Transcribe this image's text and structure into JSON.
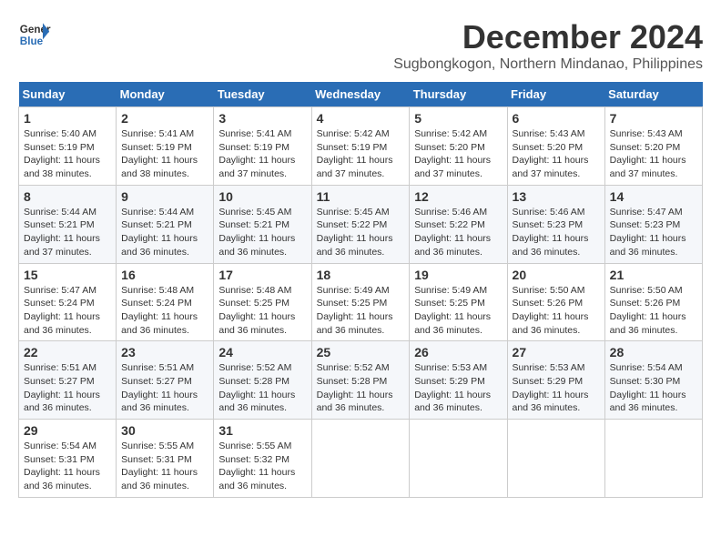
{
  "header": {
    "logo_line1": "General",
    "logo_line2": "Blue",
    "month_title": "December 2024",
    "location": "Sugbongkogon, Northern Mindanao, Philippines"
  },
  "calendar": {
    "days_of_week": [
      "Sunday",
      "Monday",
      "Tuesday",
      "Wednesday",
      "Thursday",
      "Friday",
      "Saturday"
    ],
    "weeks": [
      [
        {
          "day": "",
          "info": ""
        },
        {
          "day": "2",
          "info": "Sunrise: 5:41 AM\nSunset: 5:19 PM\nDaylight: 11 hours\nand 38 minutes."
        },
        {
          "day": "3",
          "info": "Sunrise: 5:41 AM\nSunset: 5:19 PM\nDaylight: 11 hours\nand 37 minutes."
        },
        {
          "day": "4",
          "info": "Sunrise: 5:42 AM\nSunset: 5:19 PM\nDaylight: 11 hours\nand 37 minutes."
        },
        {
          "day": "5",
          "info": "Sunrise: 5:42 AM\nSunset: 5:20 PM\nDaylight: 11 hours\nand 37 minutes."
        },
        {
          "day": "6",
          "info": "Sunrise: 5:43 AM\nSunset: 5:20 PM\nDaylight: 11 hours\nand 37 minutes."
        },
        {
          "day": "7",
          "info": "Sunrise: 5:43 AM\nSunset: 5:20 PM\nDaylight: 11 hours\nand 37 minutes."
        }
      ],
      [
        {
          "day": "1",
          "info": "Sunrise: 5:40 AM\nSunset: 5:19 PM\nDaylight: 11 hours\nand 38 minutes.",
          "sunday": true
        },
        {
          "day": "9",
          "info": "Sunrise: 5:44 AM\nSunset: 5:21 PM\nDaylight: 11 hours\nand 36 minutes."
        },
        {
          "day": "10",
          "info": "Sunrise: 5:45 AM\nSunset: 5:21 PM\nDaylight: 11 hours\nand 36 minutes."
        },
        {
          "day": "11",
          "info": "Sunrise: 5:45 AM\nSunset: 5:22 PM\nDaylight: 11 hours\nand 36 minutes."
        },
        {
          "day": "12",
          "info": "Sunrise: 5:46 AM\nSunset: 5:22 PM\nDaylight: 11 hours\nand 36 minutes."
        },
        {
          "day": "13",
          "info": "Sunrise: 5:46 AM\nSunset: 5:23 PM\nDaylight: 11 hours\nand 36 minutes."
        },
        {
          "day": "14",
          "info": "Sunrise: 5:47 AM\nSunset: 5:23 PM\nDaylight: 11 hours\nand 36 minutes."
        }
      ],
      [
        {
          "day": "8",
          "info": "Sunrise: 5:44 AM\nSunset: 5:21 PM\nDaylight: 11 hours\nand 37 minutes."
        },
        {
          "day": "16",
          "info": "Sunrise: 5:48 AM\nSunset: 5:24 PM\nDaylight: 11 hours\nand 36 minutes."
        },
        {
          "day": "17",
          "info": "Sunrise: 5:48 AM\nSunset: 5:25 PM\nDaylight: 11 hours\nand 36 minutes."
        },
        {
          "day": "18",
          "info": "Sunrise: 5:49 AM\nSunset: 5:25 PM\nDaylight: 11 hours\nand 36 minutes."
        },
        {
          "day": "19",
          "info": "Sunrise: 5:49 AM\nSunset: 5:25 PM\nDaylight: 11 hours\nand 36 minutes."
        },
        {
          "day": "20",
          "info": "Sunrise: 5:50 AM\nSunset: 5:26 PM\nDaylight: 11 hours\nand 36 minutes."
        },
        {
          "day": "21",
          "info": "Sunrise: 5:50 AM\nSunset: 5:26 PM\nDaylight: 11 hours\nand 36 minutes."
        }
      ],
      [
        {
          "day": "15",
          "info": "Sunrise: 5:47 AM\nSunset: 5:24 PM\nDaylight: 11 hours\nand 36 minutes."
        },
        {
          "day": "23",
          "info": "Sunrise: 5:51 AM\nSunset: 5:27 PM\nDaylight: 11 hours\nand 36 minutes."
        },
        {
          "day": "24",
          "info": "Sunrise: 5:52 AM\nSunset: 5:28 PM\nDaylight: 11 hours\nand 36 minutes."
        },
        {
          "day": "25",
          "info": "Sunrise: 5:52 AM\nSunset: 5:28 PM\nDaylight: 11 hours\nand 36 minutes."
        },
        {
          "day": "26",
          "info": "Sunrise: 5:53 AM\nSunset: 5:29 PM\nDaylight: 11 hours\nand 36 minutes."
        },
        {
          "day": "27",
          "info": "Sunrise: 5:53 AM\nSunset: 5:29 PM\nDaylight: 11 hours\nand 36 minutes."
        },
        {
          "day": "28",
          "info": "Sunrise: 5:54 AM\nSunset: 5:30 PM\nDaylight: 11 hours\nand 36 minutes."
        }
      ],
      [
        {
          "day": "22",
          "info": "Sunrise: 5:51 AM\nSunset: 5:27 PM\nDaylight: 11 hours\nand 36 minutes."
        },
        {
          "day": "30",
          "info": "Sunrise: 5:55 AM\nSunset: 5:31 PM\nDaylight: 11 hours\nand 36 minutes."
        },
        {
          "day": "31",
          "info": "Sunrise: 5:55 AM\nSunset: 5:32 PM\nDaylight: 11 hours\nand 36 minutes."
        },
        {
          "day": "",
          "info": ""
        },
        {
          "day": "",
          "info": ""
        },
        {
          "day": "",
          "info": ""
        },
        {
          "day": "",
          "info": ""
        }
      ],
      [
        {
          "day": "29",
          "info": "Sunrise: 5:54 AM\nSunset: 5:31 PM\nDaylight: 11 hours\nand 36 minutes."
        }
      ]
    ]
  }
}
